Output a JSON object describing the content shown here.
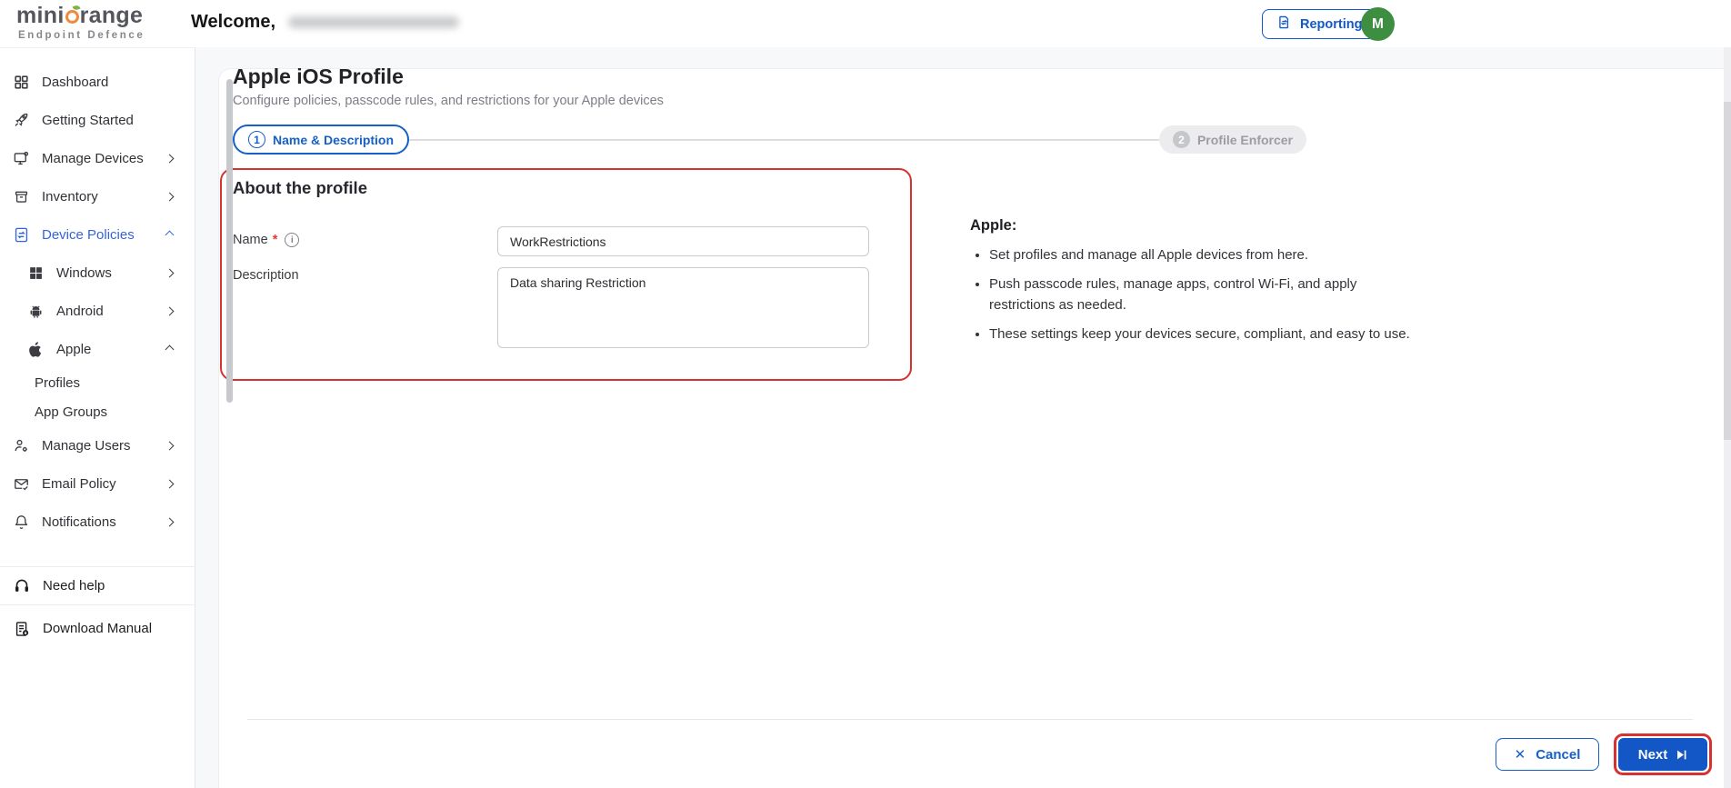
{
  "header": {
    "logo_pre": "mini",
    "logo_post": "range",
    "logo_sub": "Endpoint Defence",
    "welcome": "Welcome,",
    "reporting_label": "Reporting",
    "avatar_initial": "M"
  },
  "sidebar": {
    "items": [
      {
        "label": "Dashboard",
        "icon": "dashboard",
        "chevron": null,
        "level": 0,
        "active": false
      },
      {
        "label": "Getting Started",
        "icon": "rocket",
        "chevron": null,
        "level": 0,
        "active": false
      },
      {
        "label": "Manage Devices",
        "icon": "monitor",
        "chevron": "right",
        "level": 0,
        "active": false
      },
      {
        "label": "Inventory",
        "icon": "inventory",
        "chevron": "right",
        "level": 0,
        "active": false
      },
      {
        "label": "Device Policies",
        "icon": "policy-doc",
        "chevron": "up",
        "level": 0,
        "active": true
      },
      {
        "label": "Windows",
        "icon": "windows",
        "chevron": "right",
        "level": 1,
        "active": false
      },
      {
        "label": "Android",
        "icon": "android",
        "chevron": "right",
        "level": 1,
        "active": false
      },
      {
        "label": "Apple",
        "icon": "apple",
        "chevron": "up",
        "level": 1,
        "active": false
      },
      {
        "label": "Profiles",
        "icon": null,
        "chevron": null,
        "level": 2,
        "active": false
      },
      {
        "label": "App Groups",
        "icon": null,
        "chevron": null,
        "level": 2,
        "active": false
      },
      {
        "label": "Manage Users",
        "icon": "user-gear",
        "chevron": "right",
        "level": 0,
        "active": false
      },
      {
        "label": "Email Policy",
        "icon": "mail-check",
        "chevron": "right",
        "level": 0,
        "active": false
      },
      {
        "label": "Notifications",
        "icon": "bell",
        "chevron": "right",
        "level": 0,
        "active": false
      }
    ],
    "footer_items": [
      {
        "label": "Need help",
        "icon": "headset"
      },
      {
        "label": "Download Manual",
        "icon": "doc-download"
      }
    ]
  },
  "page": {
    "title": "Apple iOS Profile",
    "subtitle": "Configure policies, passcode rules, and restrictions for your Apple devices"
  },
  "stepper": {
    "step1_num": "1",
    "step1_label": "Name & Description",
    "step2_num": "2",
    "step2_label": "Profile Enforcer"
  },
  "form": {
    "section_title": "About the profile",
    "name_label": "Name",
    "required_mark": "*",
    "info_glyph": "i",
    "name_value": "WorkRestrictions",
    "description_label": "Description",
    "description_value": "Data sharing Restriction"
  },
  "info_panel": {
    "title": "Apple:",
    "bullets": [
      "Set profiles and manage all Apple devices from here.",
      "Push passcode rules, manage apps, control Wi-Fi, and apply restrictions as needed.",
      "These settings keep your devices secure, compliant, and easy to use."
    ]
  },
  "footer": {
    "cancel_icon": "✕",
    "cancel_label": "Cancel",
    "next_label": "Next"
  },
  "colors": {
    "primary_blue": "#1356c5",
    "sidebar_active_blue": "#3464dd",
    "annotation_red": "#d63231",
    "avatar_green": "#3e8e42",
    "brand_orange": "#f08a3c"
  }
}
